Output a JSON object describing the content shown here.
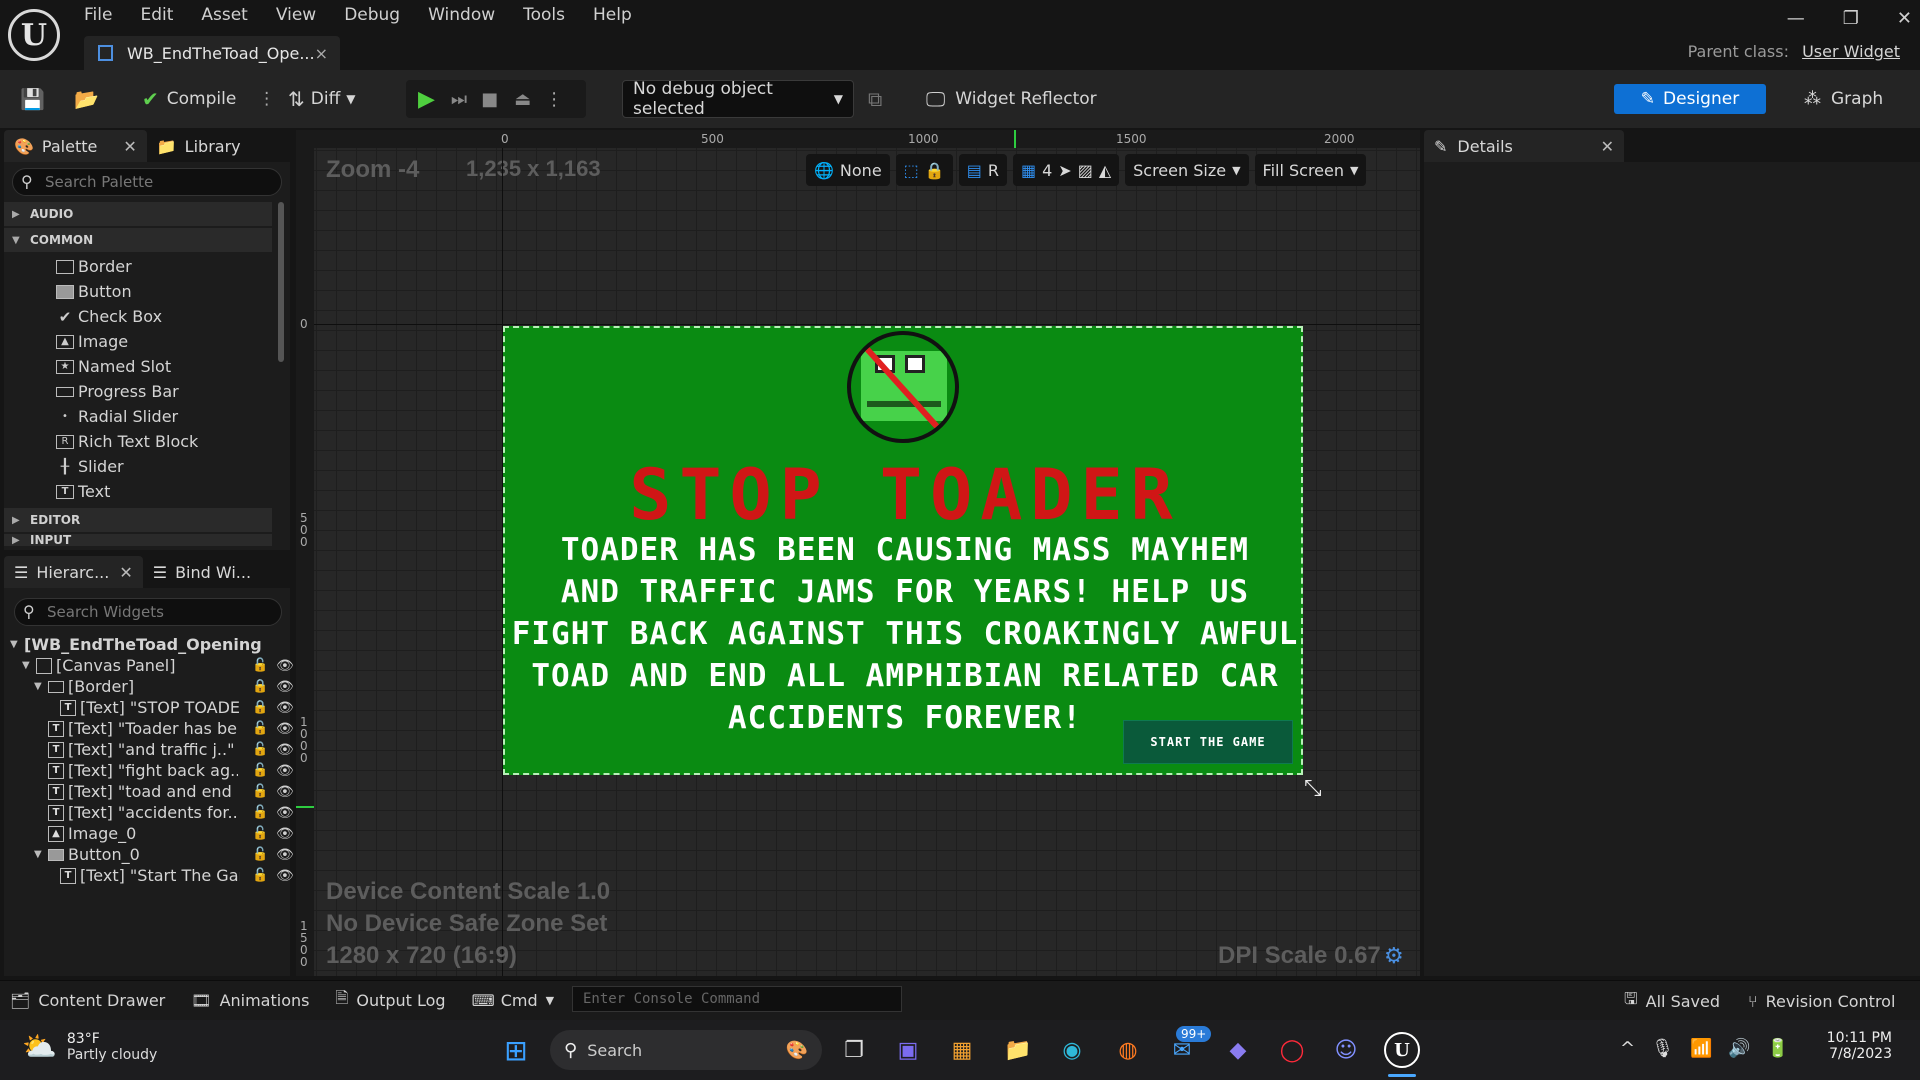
{
  "menu": [
    "File",
    "Edit",
    "Asset",
    "View",
    "Debug",
    "Window",
    "Tools",
    "Help"
  ],
  "doc_tab": {
    "label": "WB_EndTheToad_Ope...",
    "close": "×"
  },
  "window_controls": {
    "minimize": "—",
    "restore": "❐",
    "close": "✕"
  },
  "parent_class": {
    "label": "Parent class:",
    "value": "User Widget"
  },
  "toolbar": {
    "compile": "Compile",
    "diff": "Diff",
    "debug_object": "No debug object selected",
    "widget_reflector": "Widget Reflector",
    "designer": "Designer",
    "graph": "Graph"
  },
  "palette": {
    "tab_palette": "Palette",
    "tab_library": "Library",
    "search_placeholder": "Search Palette",
    "categories": {
      "audio": "AUDIO",
      "common": "COMMON",
      "editor": "EDITOR",
      "input": "INPUT"
    },
    "items": [
      "Border",
      "Button",
      "Check Box",
      "Image",
      "Named Slot",
      "Progress Bar",
      "Radial Slider",
      "Rich Text Block",
      "Slider",
      "Text"
    ]
  },
  "hierarchy": {
    "tab_hierarchy": "Hierarc...",
    "tab_bind": "Bind Wi...",
    "search_placeholder": "Search Widgets",
    "rows": [
      "[WB_EndTheToad_Opening",
      "[Canvas Panel]",
      "[Border]",
      "[Text] \"STOP TOADE",
      "[Text] \"Toader has be.",
      "[Text] \"and traffic j..\"",
      "[Text] \"fight back ag..\"",
      "[Text] \"toad and end ..\"",
      "[Text] \"accidents for..\"",
      "Image_0",
      "Button_0",
      "[Text] \"Start The Gar"
    ]
  },
  "details": {
    "tab": "Details"
  },
  "viewport": {
    "zoom": "Zoom -4",
    "size": "1,235 x 1,163",
    "ruler_top": [
      "0",
      "500",
      "1000",
      "1500",
      "2000"
    ],
    "ruler_left": [
      "0",
      "5\n0\n0",
      "1\n0\n0\n0",
      "1\n5\n0\n0"
    ],
    "vp_none": "None",
    "vp_r": "R",
    "vp_grid": "4",
    "screen_size": "Screen Size",
    "fill_screen": "Fill Screen",
    "device_scale": "Device Content Scale 1.0",
    "safe_zone": "No Device Safe Zone Set",
    "resolution": "1280 x 720 (16:9)",
    "dpi": "DPI Scale 0.67"
  },
  "widget": {
    "title": "STOP TOADER",
    "lines": [
      "TOADER HAS BEEN CAUSING MASS MAYHEM",
      "AND TRAFFIC JAMS FOR YEARS! HELP US",
      "FIGHT BACK AGAINST THIS CROAKINGLY AWFUL",
      "TOAD AND END ALL AMPHIBIAN RELATED CAR",
      "ACCIDENTS FOREVER!"
    ],
    "button": "START THE GAME",
    "colors": {
      "bg": "#0a8b12",
      "title": "#d01616"
    }
  },
  "bottombar": {
    "content_drawer": "Content Drawer",
    "animations": "Animations",
    "output_log": "Output Log",
    "cmd": "Cmd",
    "console_placeholder": "Enter Console Command",
    "all_saved": "All Saved",
    "revision_control": "Revision Control"
  },
  "taskbar": {
    "weather_temp": "83°F",
    "weather_desc": "Partly cloudy",
    "search": "Search",
    "mail_badge": "99+",
    "time": "10:11 PM",
    "date": "7/8/2023"
  }
}
